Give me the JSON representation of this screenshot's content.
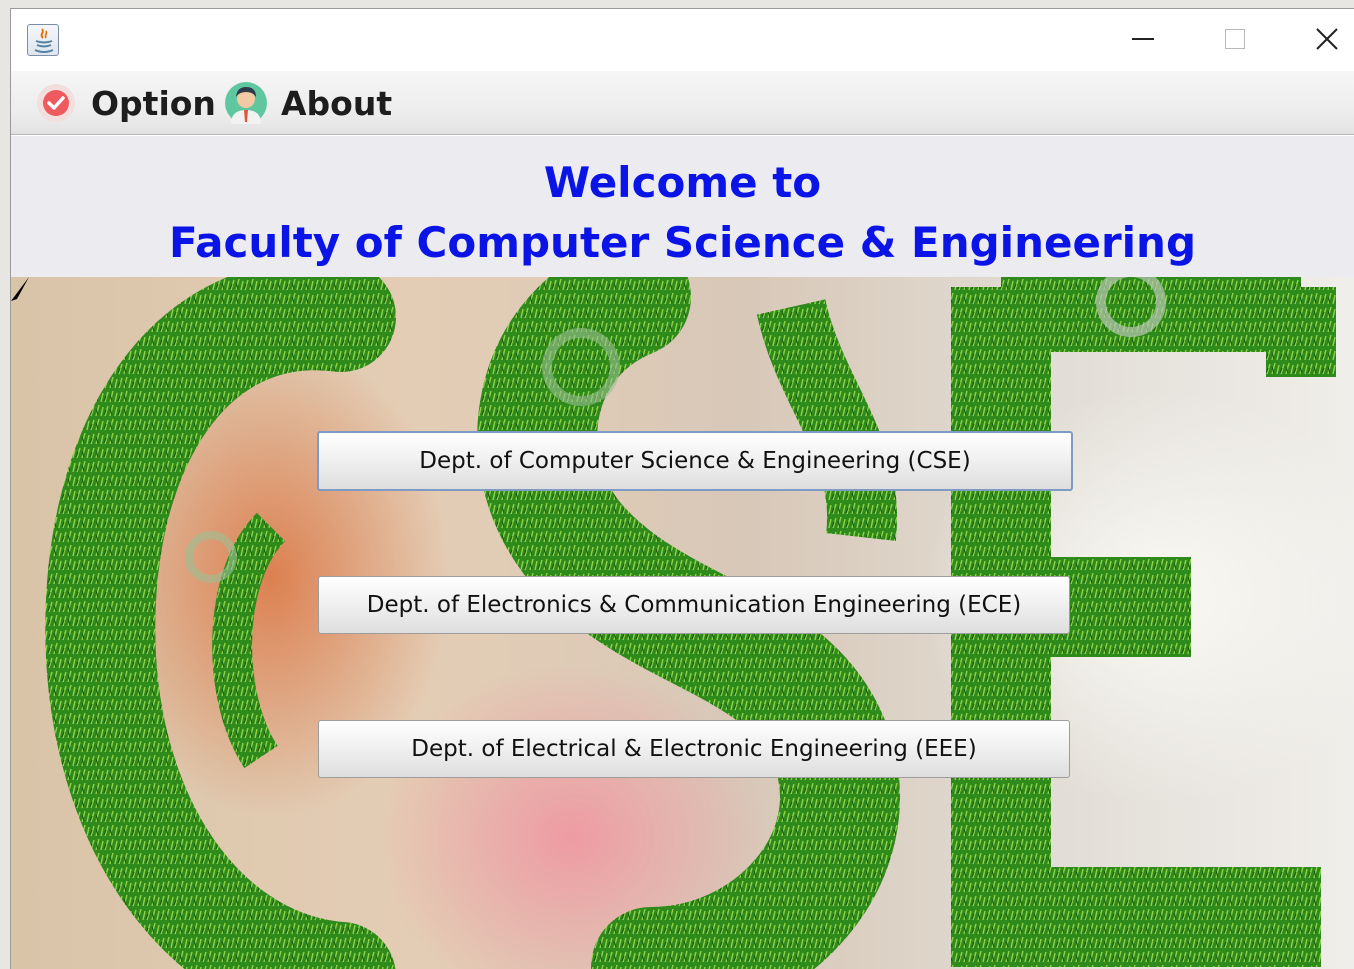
{
  "menu": {
    "option_label": "Option",
    "about_label": "About"
  },
  "header": {
    "line1": "Welcome to",
    "line2": "Faculty of Computer Science & Engineering"
  },
  "departments": [
    {
      "label": "Dept. of Computer Science & Engineering (CSE)"
    },
    {
      "label": "Dept. of Electronics & Communication Engineering (ECE)"
    },
    {
      "label": "Dept. of Electrical & Electronic Engineering (EEE)"
    }
  ],
  "icons": {
    "app": "java-icon",
    "option": "check-badge-icon",
    "about": "person-icon",
    "minimize": "minimize-icon",
    "maximize": "maximize-icon",
    "close": "close-icon"
  },
  "colors": {
    "heading": "#0a14e6",
    "header_band": "#ebebf0",
    "menubar": "#ececec",
    "grass": "#2f8a1c"
  }
}
